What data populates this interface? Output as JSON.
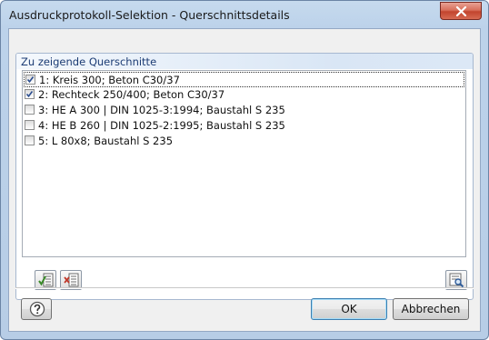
{
  "window": {
    "title": "Ausdruckprotokoll-Selektion - Querschnittsdetails"
  },
  "group": {
    "title": "Zu zeigende Querschnitte"
  },
  "cross_sections": [
    {
      "label": "1: Kreis 300; Beton C30/37",
      "checked": true
    },
    {
      "label": "2: Rechteck 250/400; Beton C30/37",
      "checked": true
    },
    {
      "label": "3: HE A 300 | DIN 1025-3:1994; Baustahl S 235",
      "checked": false
    },
    {
      "label": "4: HE B 260 | DIN 1025-2:1995; Baustahl S 235",
      "checked": false
    },
    {
      "label": "5: L 80x8; Baustahl S 235",
      "checked": false
    }
  ],
  "buttons": {
    "ok_label": "OK",
    "cancel_label": "Abbrechen"
  },
  "icons": {
    "close": "close-icon",
    "select_all": "select-all-icon",
    "deselect_all": "deselect-all-icon",
    "view": "view-selection-icon",
    "help": "help-icon"
  }
}
